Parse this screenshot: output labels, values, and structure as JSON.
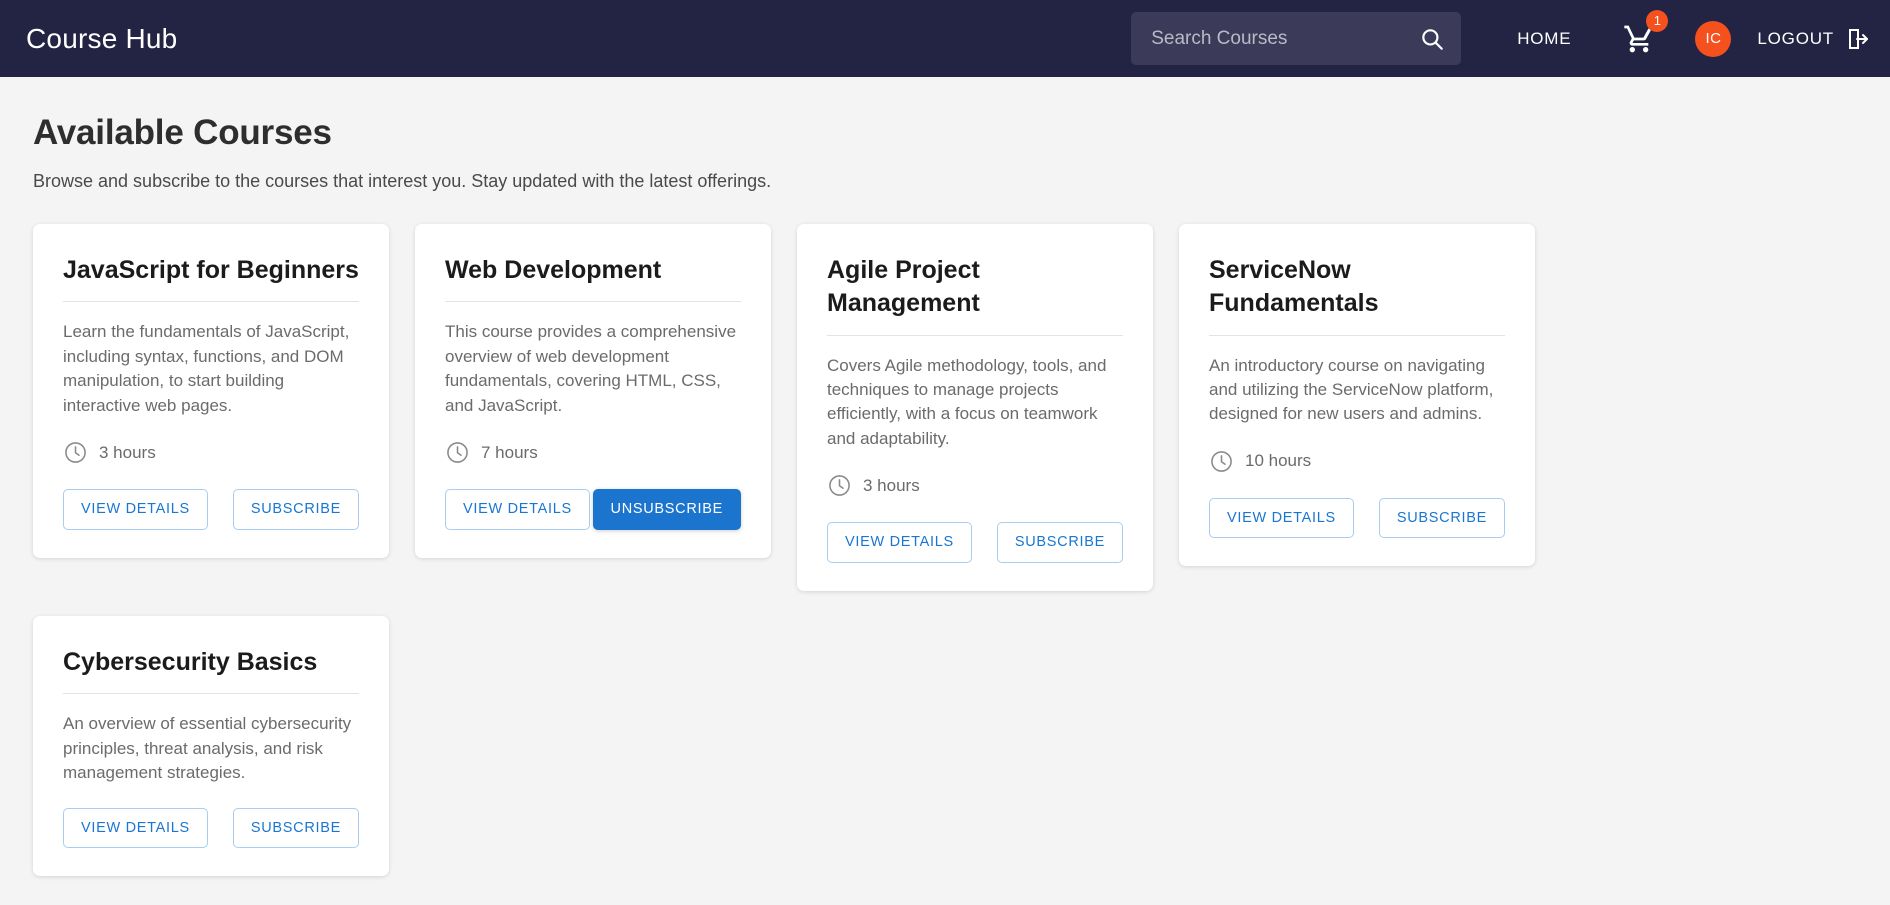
{
  "header": {
    "brand": "Course Hub",
    "search": {
      "placeholder": "Search Courses",
      "value": "",
      "icon": "search-icon"
    },
    "home_label": "HOME",
    "cart": {
      "icon": "shopping-cart-icon",
      "badge": "1"
    },
    "avatar": {
      "initials": "IC",
      "color": "#f4511e"
    },
    "logout_label": "LOGOUT",
    "logout_icon": "logout-icon",
    "background_color": "#232343"
  },
  "main": {
    "title": "Available Courses",
    "subtitle": "Browse and subscribe to the courses that interest you. Stay updated with the latest offerings.",
    "accent_color": "#1976d2"
  },
  "courses": [
    {
      "title": "JavaScript for Beginners",
      "description": "Learn the fundamentals of JavaScript, including syntax, functions, and DOM manipulation, to start building interactive web pages.",
      "duration": "3 hours",
      "view_label": "VIEW DETAILS",
      "action_label": "SUBSCRIBE",
      "subscribed": false
    },
    {
      "title": "Web Development",
      "description": "This course provides a comprehensive overview of web development fundamentals, covering HTML, CSS, and JavaScript.",
      "duration": "7 hours",
      "view_label": "VIEW DETAILS",
      "action_label": "UNSUBSCRIBE",
      "subscribed": true
    },
    {
      "title": "Agile Project Management",
      "description": "Covers Agile methodology, tools, and techniques to manage projects efficiently, with a focus on teamwork and adaptability.",
      "duration": "3 hours",
      "view_label": "VIEW DETAILS",
      "action_label": "SUBSCRIBE",
      "subscribed": false
    },
    {
      "title": "ServiceNow Fundamentals",
      "description": "An introductory course on navigating and utilizing the ServiceNow platform, designed for new users and admins.",
      "duration": "10 hours",
      "view_label": "VIEW DETAILS",
      "action_label": "SUBSCRIBE",
      "subscribed": false
    },
    {
      "title": "Cybersecurity Basics",
      "description": "An overview of essential cybersecurity principles, threat analysis, and risk management strategies.",
      "duration": "",
      "view_label": "VIEW DETAILS",
      "action_label": "SUBSCRIBE",
      "subscribed": false
    }
  ]
}
